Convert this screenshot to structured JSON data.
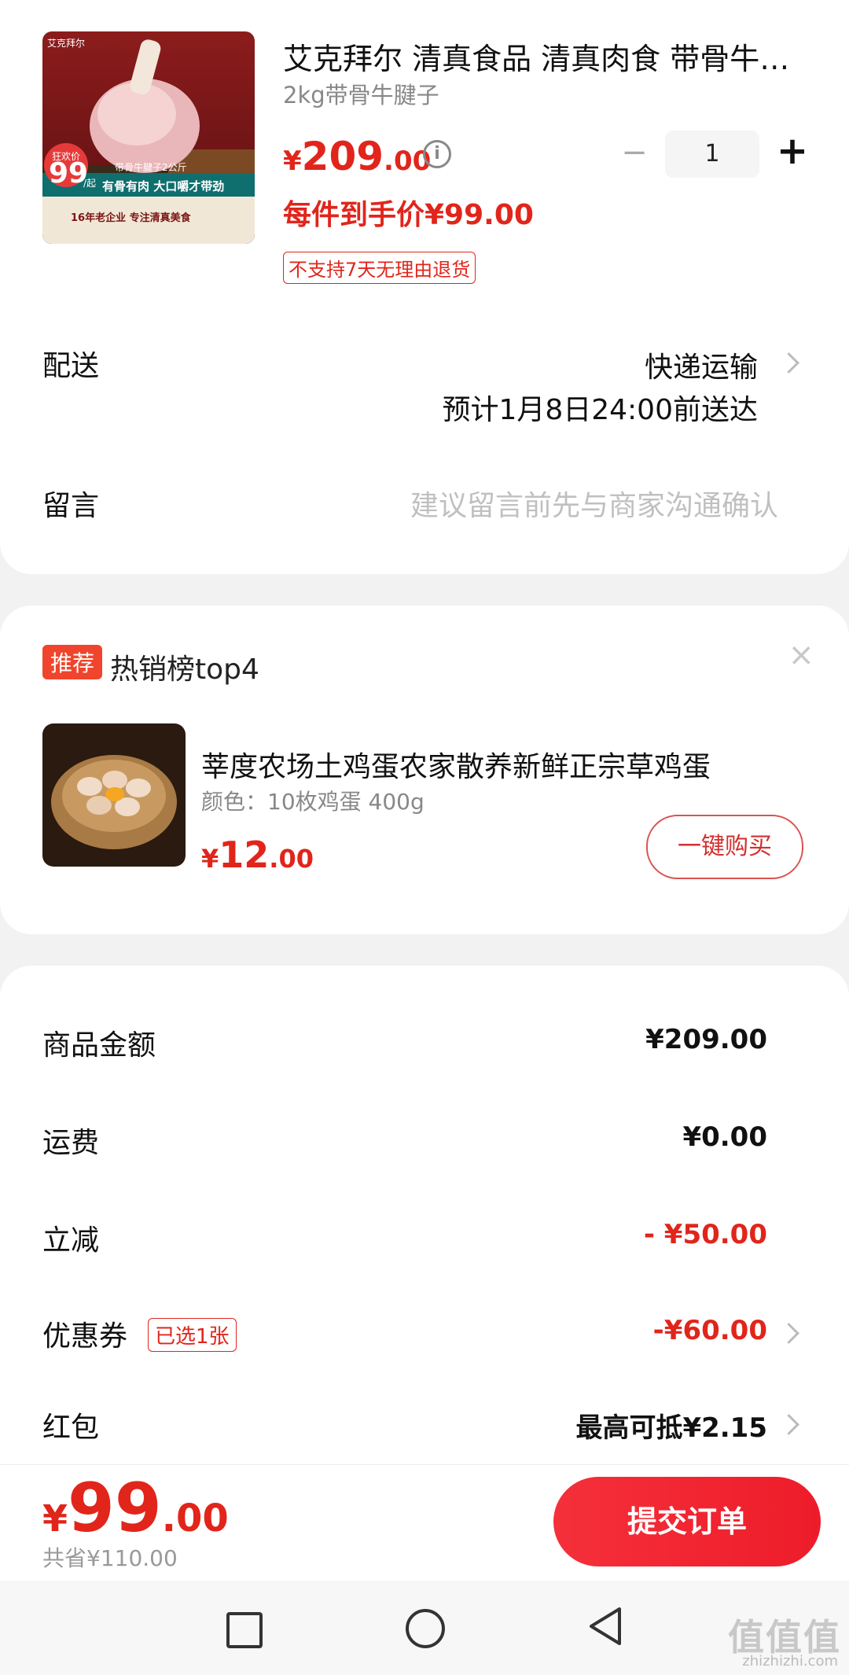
{
  "product": {
    "title": "艾克拜尔 清真食品 清真肉食 带骨牛腱子",
    "spec": "2kg带骨牛腱子",
    "price_symbol": "¥",
    "price_int": "209",
    "price_dec": ".00",
    "quantity": "1",
    "per_item_price": "每件到手价¥99.00",
    "return_policy": "不支持7天无理由退货",
    "image_text": {
      "brand": "艾克拜尔",
      "badge_top": "狂欢价",
      "badge_num": "99",
      "badge_unit": "/起",
      "line1": "带骨牛腱子2公斤",
      "line2": "有骨有肉 大口嚼才带劲",
      "line3": "16年老企业 专注清真美食"
    }
  },
  "delivery": {
    "label": "配送",
    "method": "快递运输",
    "eta": "预计1月8日24:00前送达"
  },
  "remark": {
    "label": "留言",
    "placeholder": "建议留言前先与商家沟通确认"
  },
  "recommend": {
    "badge": "推荐",
    "title": "热销榜top4",
    "close": "×",
    "item": {
      "name": "莘度农场土鸡蛋农家散养新鲜正宗草鸡蛋",
      "spec": "颜色：10枚鸡蛋 400g",
      "price_symbol": "¥",
      "price_int": "12",
      "price_dec": ".00",
      "button": "一键购买"
    }
  },
  "summary": {
    "goods_label": "商品金额",
    "goods_value": "¥209.00",
    "shipping_label": "运费",
    "shipping_value": "¥0.00",
    "discount_label": "立减",
    "discount_value": "- ¥50.00",
    "coupon_label": "优惠券",
    "coupon_tag": "已选1张",
    "coupon_value": "-¥60.00",
    "redpacket_label": "红包",
    "redpacket_value": "最高可抵¥2.15"
  },
  "footer": {
    "total_symbol": "¥",
    "total_int": "99",
    "total_dec": ".00",
    "saved": "共省¥110.00",
    "submit": "提交订单"
  },
  "watermark": {
    "text": "值值值",
    "url": "zhizhizhi.com"
  },
  "colors": {
    "accent": "#e1251b",
    "submit_gradient_start": "#f5303a",
    "submit_gradient_end": "#ee1c2a"
  }
}
